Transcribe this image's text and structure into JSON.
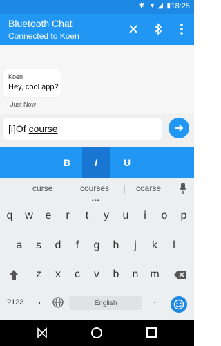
{
  "status": {
    "time": "18:25"
  },
  "app": {
    "title": "Bluetooth Chat",
    "subtitle": "Connected to Koen",
    "accent": "#2196f3"
  },
  "chat": {
    "messages": [
      {
        "sender": "Koen",
        "text": "Hey, cool app?",
        "time": "Just Now"
      }
    ]
  },
  "composer": {
    "text_prefix": "[i]Of",
    "text_word": "course",
    "send_icon": "arrow-right-icon"
  },
  "format_bar": {
    "bold": "B",
    "italic": "I",
    "underline": "U"
  },
  "keyboard": {
    "suggestions": [
      "curse",
      "courses",
      "coarse"
    ],
    "row1": [
      "q",
      "w",
      "e",
      "r",
      "t",
      "y",
      "u",
      "i",
      "o",
      "p"
    ],
    "row2": [
      "a",
      "s",
      "d",
      "f",
      "g",
      "h",
      "j",
      "k",
      "l"
    ],
    "row3": [
      "z",
      "x",
      "c",
      "v",
      "b",
      "n",
      "m"
    ],
    "symbols_label": "?123",
    "comma_label": ",",
    "space_label": "English",
    "period_label": "."
  }
}
